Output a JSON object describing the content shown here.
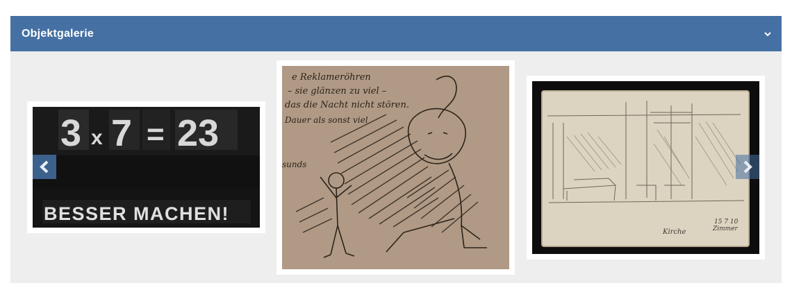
{
  "panel": {
    "title": "Objektgalerie",
    "header_color": "#4570a3",
    "toggle_icon": "chevron-down-icon"
  },
  "carousel": {
    "prev_icon": "chevron-left-icon",
    "next_icon": "chevron-right-icon",
    "items": [
      {
        "kind": "poster-photo",
        "equation": [
          "3",
          "x",
          "7",
          "=",
          "23"
        ],
        "slogan": "BESSER MACHEN!"
      },
      {
        "kind": "ink-sketch",
        "lines": [
          "e Reklameröhren",
          "– sie glänzen zu viel –",
          "das die Nacht nicht stören.",
          "Dauer als sonst viel"
        ],
        "margin_text": "sunds"
      },
      {
        "kind": "pencil-sketch",
        "signature": "Kirche",
        "date": "15 7 10",
        "note": "Zimmer"
      }
    ]
  }
}
